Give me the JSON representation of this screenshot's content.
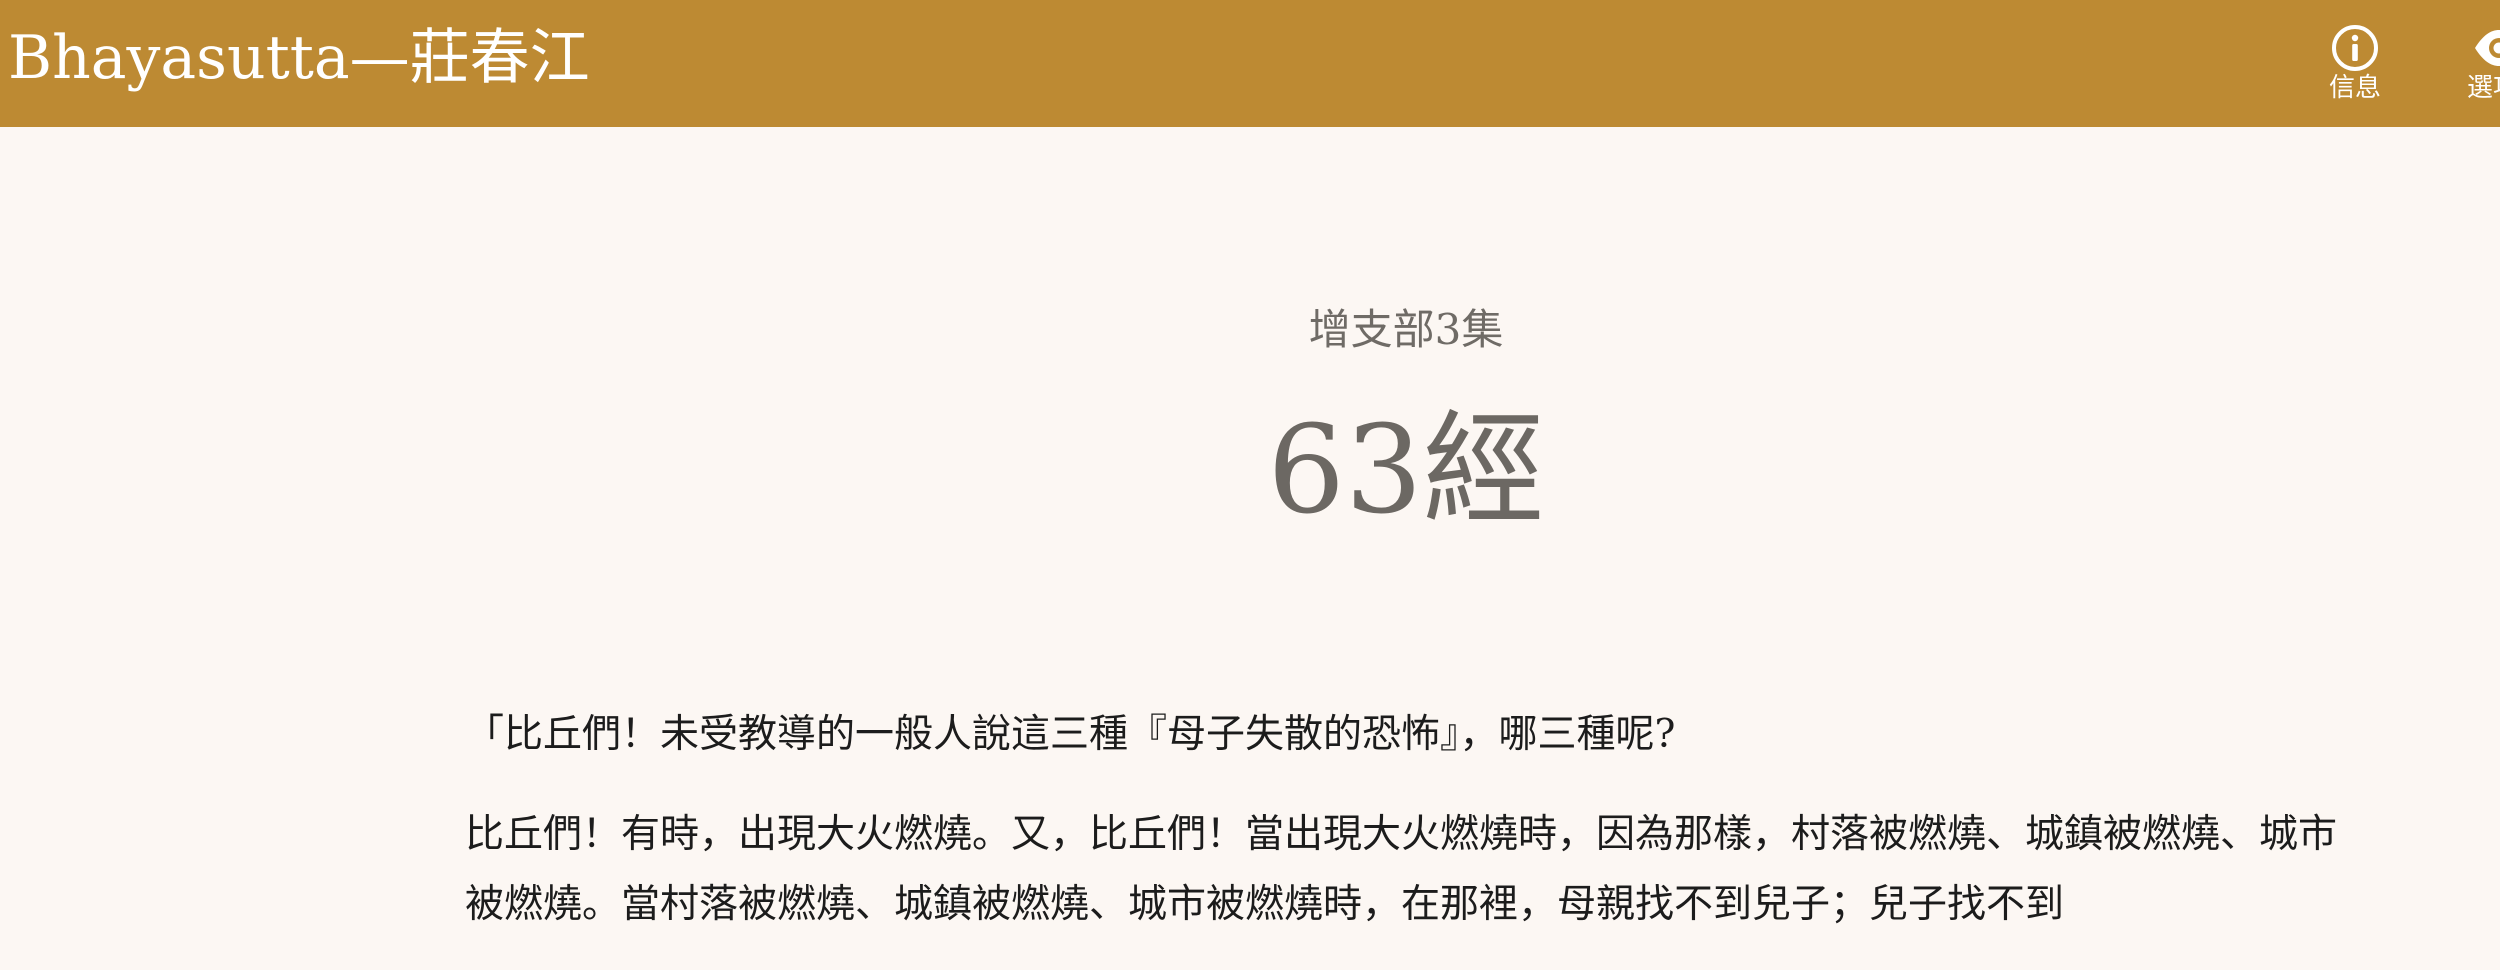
{
  "header": {
    "title": "Bhayasutta—莊春江",
    "info_label": "信息",
    "options_label": "選項",
    "info_icon": "info-circle-icon",
    "options_icon": "eye-icon",
    "bar_color": "#bd8a33"
  },
  "content": {
    "subtitle": "增支部3集",
    "title": "63經",
    "paragraphs": [
      "「比丘們！未受教導的一般人說這三種『母子失散的恐怖』，哪三種呢?",
      "比丘們！有時，出現大火燃燒。又，比丘們！當出現大火燃燒時，因為那樣，村落被燃燒、城鎮被燃燒、城市被燃燒。當村落被燃燒、城鎮被燃燒、城市被燃燒時，在那裡，母親找不到兒子；兒子找不到"
    ]
  }
}
